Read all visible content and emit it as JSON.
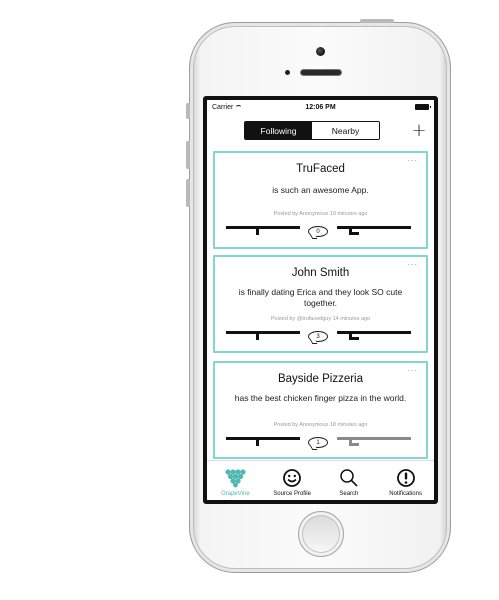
{
  "status_bar": {
    "carrier": "Carrier",
    "time": "12:06 PM"
  },
  "nav": {
    "segments": [
      {
        "label": "Following",
        "active": true
      },
      {
        "label": "Nearby",
        "active": false
      }
    ],
    "add_label": "+"
  },
  "posts": [
    {
      "author": "TruFaced",
      "text": "is such an awesome App.",
      "meta": "Posted by Anonymous 10 minutes ago",
      "comments": "0",
      "menu": "..."
    },
    {
      "author": "John Smith",
      "text": "is finally dating Erica and they look SO cute together.",
      "meta": "Posted by @trufacedguy 14 minutes ago",
      "comments": "3",
      "menu": "..."
    },
    {
      "author": "Bayside Pizzeria",
      "text": "has the best chicken finger pizza in the world.",
      "meta": "Posted by Anonymous 18 minutes ago",
      "comments": "1",
      "menu": "..."
    }
  ],
  "tabs": [
    {
      "label": "GrapeVine",
      "icon": "grapes-icon",
      "active": true
    },
    {
      "label": "Source Profile",
      "icon": "smiley-icon",
      "active": false
    },
    {
      "label": "Search",
      "icon": "magnifier-icon",
      "active": false
    },
    {
      "label": "Notifications",
      "icon": "exclamation-icon",
      "active": false
    }
  ],
  "colors": {
    "accent": "#4fb8b3",
    "card_border": "#7fd6d2",
    "dark": "#111111",
    "inactive_vote": "#8a8a8a"
  }
}
